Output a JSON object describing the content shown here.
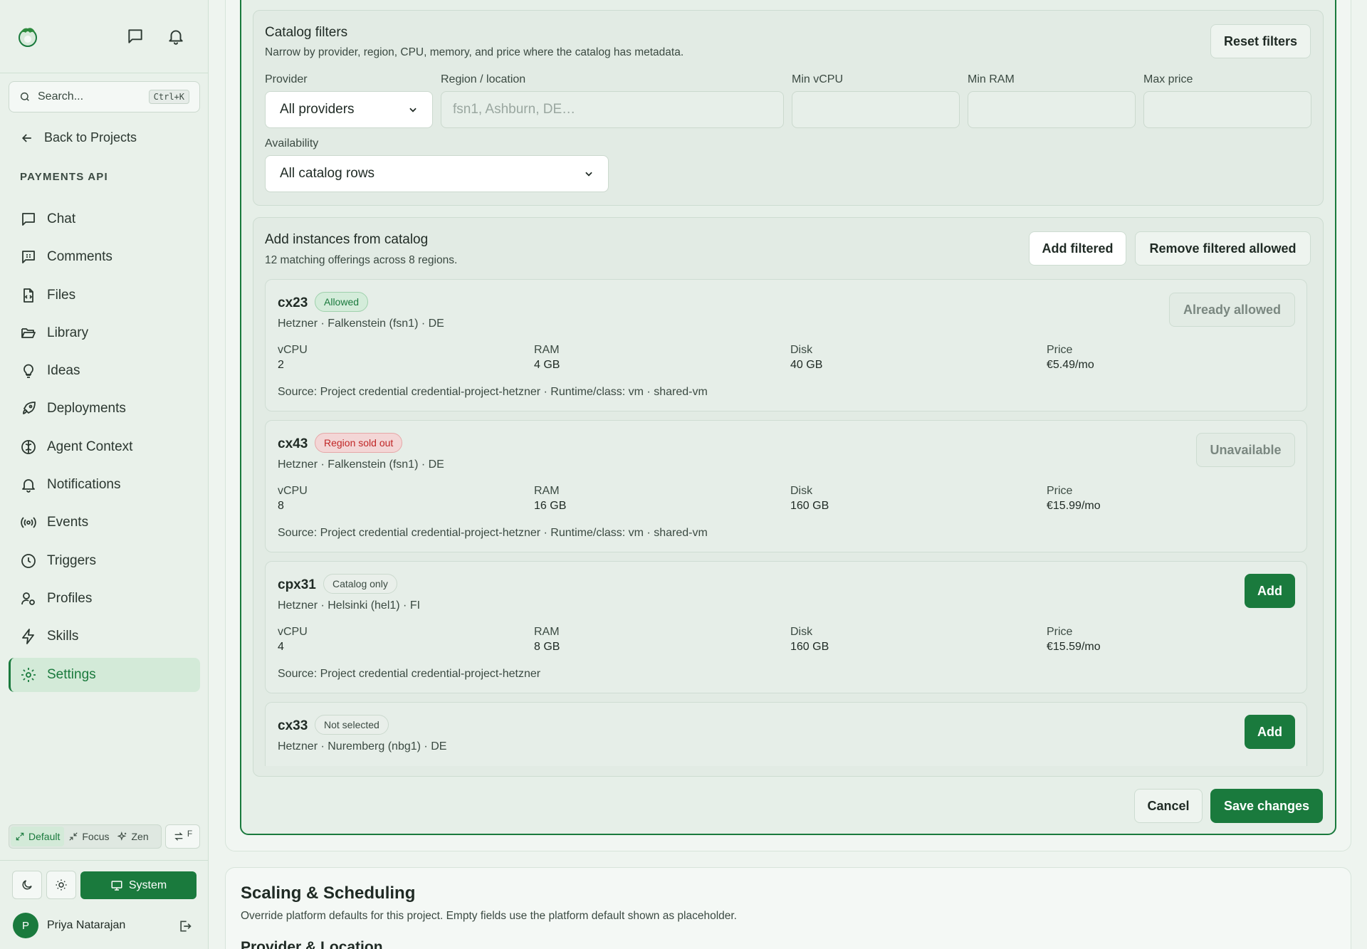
{
  "sidebar": {
    "search_placeholder": "Search...",
    "search_shortcut": "Ctrl+K",
    "back_label": "Back to Projects",
    "project_label": "PAYMENTS API",
    "items": [
      {
        "label": "Chat",
        "icon": "chat-icon"
      },
      {
        "label": "Comments",
        "icon": "comments-icon"
      },
      {
        "label": "Files",
        "icon": "file-code-icon"
      },
      {
        "label": "Library",
        "icon": "folder-open-icon"
      },
      {
        "label": "Ideas",
        "icon": "lightbulb-icon"
      },
      {
        "label": "Deployments",
        "icon": "rocket-icon"
      },
      {
        "label": "Agent Context",
        "icon": "brain-icon"
      },
      {
        "label": "Notifications",
        "icon": "bell-icon"
      },
      {
        "label": "Events",
        "icon": "broadcast-icon"
      },
      {
        "label": "Triggers",
        "icon": "clock-icon"
      },
      {
        "label": "Profiles",
        "icon": "user-cog-icon"
      },
      {
        "label": "Skills",
        "icon": "zap-icon"
      },
      {
        "label": "Settings",
        "icon": "gear-icon",
        "active": true
      }
    ],
    "modes": {
      "default": "Default",
      "focus": "Focus",
      "zen": "Zen",
      "toggle_key": "F"
    },
    "theme": {
      "system": "System"
    },
    "user": {
      "initial": "P",
      "name": "Priya Natarajan"
    }
  },
  "filters": {
    "title": "Catalog filters",
    "subtitle": "Narrow by provider, region, CPU, memory, and price where the catalog has metadata.",
    "reset_label": "Reset filters",
    "provider_label": "Provider",
    "provider_value": "All providers",
    "region_label": "Region / location",
    "region_placeholder": "fsn1, Ashburn, DE…",
    "min_vcpu_label": "Min vCPU",
    "min_ram_label": "Min RAM",
    "max_price_label": "Max price",
    "availability_label": "Availability",
    "availability_value": "All catalog rows"
  },
  "instances": {
    "title": "Add instances from catalog",
    "subtitle": "12 matching offerings across 8 regions.",
    "add_filtered_label": "Add filtered",
    "remove_filtered_label": "Remove filtered allowed",
    "spec_labels": {
      "vcpu": "vCPU",
      "ram": "RAM",
      "disk": "Disk",
      "price": "Price"
    },
    "rows": [
      {
        "name": "cx23",
        "badge": "Allowed",
        "location": "Hetzner · Falkenstein (fsn1) · DE",
        "vcpu": "2",
        "ram": "4 GB",
        "disk": "40 GB",
        "price": "€5.49/mo",
        "source": "Source: Project credential credential-project-hetzner · Runtime/class: vm · shared-vm",
        "action": "Already allowed"
      },
      {
        "name": "cx43",
        "badge": "Region sold out",
        "location": "Hetzner · Falkenstein (fsn1) · DE",
        "vcpu": "8",
        "ram": "16 GB",
        "disk": "160 GB",
        "price": "€15.99/mo",
        "source": "Source: Project credential credential-project-hetzner · Runtime/class: vm · shared-vm",
        "action": "Unavailable"
      },
      {
        "name": "cpx31",
        "badge": "Catalog only",
        "location": "Hetzner · Helsinki (hel1) · FI",
        "vcpu": "4",
        "ram": "8 GB",
        "disk": "160 GB",
        "price": "€15.59/mo",
        "source": "Source: Project credential credential-project-hetzner",
        "action": "Add"
      },
      {
        "name": "cx33",
        "badge": "Not selected",
        "location": "Hetzner · Nuremberg (nbg1) · DE",
        "action": "Add"
      }
    ]
  },
  "footer": {
    "cancel_label": "Cancel",
    "save_label": "Save changes"
  },
  "scaling": {
    "title": "Scaling & Scheduling",
    "subtitle": "Override platform defaults for this project. Empty fields use the platform default shown as placeholder.",
    "next_heading": "Provider & Location"
  }
}
